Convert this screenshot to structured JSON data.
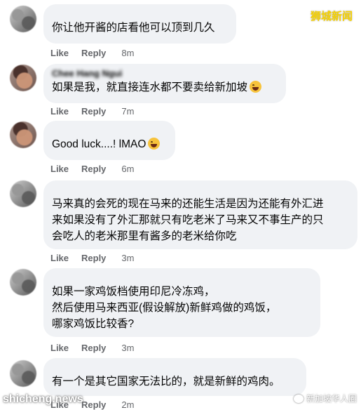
{
  "watermarks": {
    "top_right": "狮城新闻",
    "bottom_left": "shicheng.news",
    "bottom_right": "新加坡华人圈"
  },
  "action_labels": {
    "like": "Like",
    "reply": "Reply"
  },
  "comments": [
    {
      "author": "",
      "text": "你让他开酱的店看他可以顶到几久",
      "time": "8m"
    },
    {
      "author": "Chee Hang Ngui",
      "text": "如果是我，就直接连水都不要卖给新加坡",
      "emoji": "laughing-tears",
      "time": "7m"
    },
    {
      "author": "",
      "text": "Good luck....! lMAO",
      "emoji": "laughing-tears",
      "time": "6m"
    },
    {
      "author": "",
      "text": "马来真的会死的现在马来的还能生活是因为还能有外汇进\n来如果没有了外汇那就只有吃老米了马来又不事生产的只\n会吃人的老米那里有酱多的老米给你吃",
      "time": "3m"
    },
    {
      "author": "",
      "text": "如果一家鸡饭档使用印尼冷冻鸡，\n然后使用马来西亚(假设解放)新鲜鸡做的鸡饭，\n哪家鸡饭比较香?",
      "time": "3m"
    },
    {
      "author": "",
      "text": "有一个是其它国家无法比的，就是新鲜的鸡肉。",
      "time": "2m"
    }
  ]
}
